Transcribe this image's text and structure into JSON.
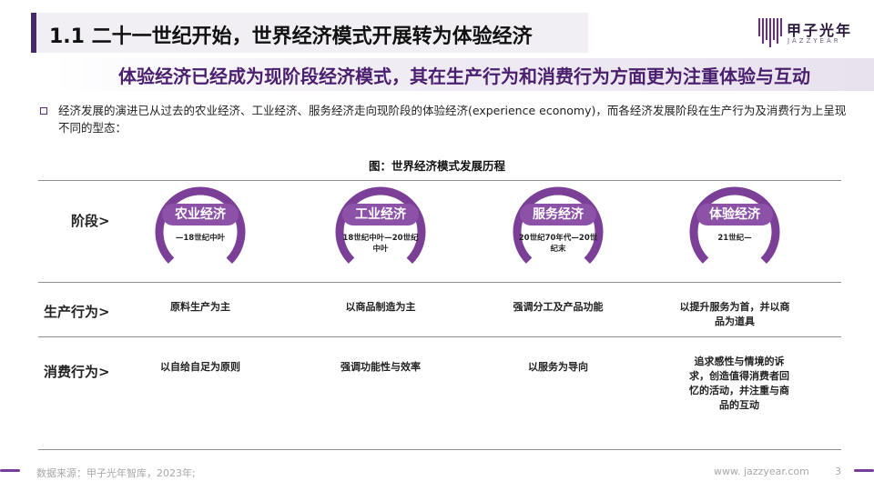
{
  "header": {
    "title": "1.1 二十一世纪开始，世界经济模式开展转为体验经济",
    "subtitle": "体验经济已经成为现阶段经济模式，其在生产行为和消费行为方面更为注重体验与互动"
  },
  "logo": {
    "name_cn": "甲子光年",
    "name_en": "JAZZYEAR",
    "icon": "jazzyear-bars-logo-icon"
  },
  "intro": {
    "text": "经济发展的演进已从过去的农业经济、工业经济、服务经济走向现阶段的体验经济(experience economy)，而各经济发展阶段在生产行为及消费行为上呈现不同的型态："
  },
  "figure": {
    "title": "图：世界经济模式发展历程"
  },
  "rows": {
    "stage_label": "阶段>",
    "production_label": "生产行为>",
    "consumption_label": "消费行为>"
  },
  "stages": [
    {
      "name": "农业经济",
      "period": "—18世纪中叶",
      "production": "原料生产为主",
      "consumption": "以自给自足为原则"
    },
    {
      "name": "工业经济",
      "period": "18世纪中叶—20世纪中叶",
      "production": "以商品制造为主",
      "consumption": "强调功能性与效率"
    },
    {
      "name": "服务经济",
      "period": "20世纪70年代—20世纪末",
      "production": "强调分工及产品功能",
      "consumption": "以服务为导向"
    },
    {
      "name": "体验经济",
      "period": "21世纪—",
      "production": "以提升服务为首，并以商品为道具",
      "consumption": "追求感性与情境的诉求，创造值得消费者回忆的活动，并注重与商品的互动"
    }
  ],
  "footer": {
    "source": "数据来源：甲子光年智库，2023年;",
    "url": "www. jazzyear.com",
    "page": "3"
  },
  "colors": {
    "accent": "#8c52a8",
    "ring": "#7b3f98",
    "title_bar": "#f1eff3",
    "title_edge": "#4a2a66",
    "subtitle_text": "#4a1f6e"
  }
}
